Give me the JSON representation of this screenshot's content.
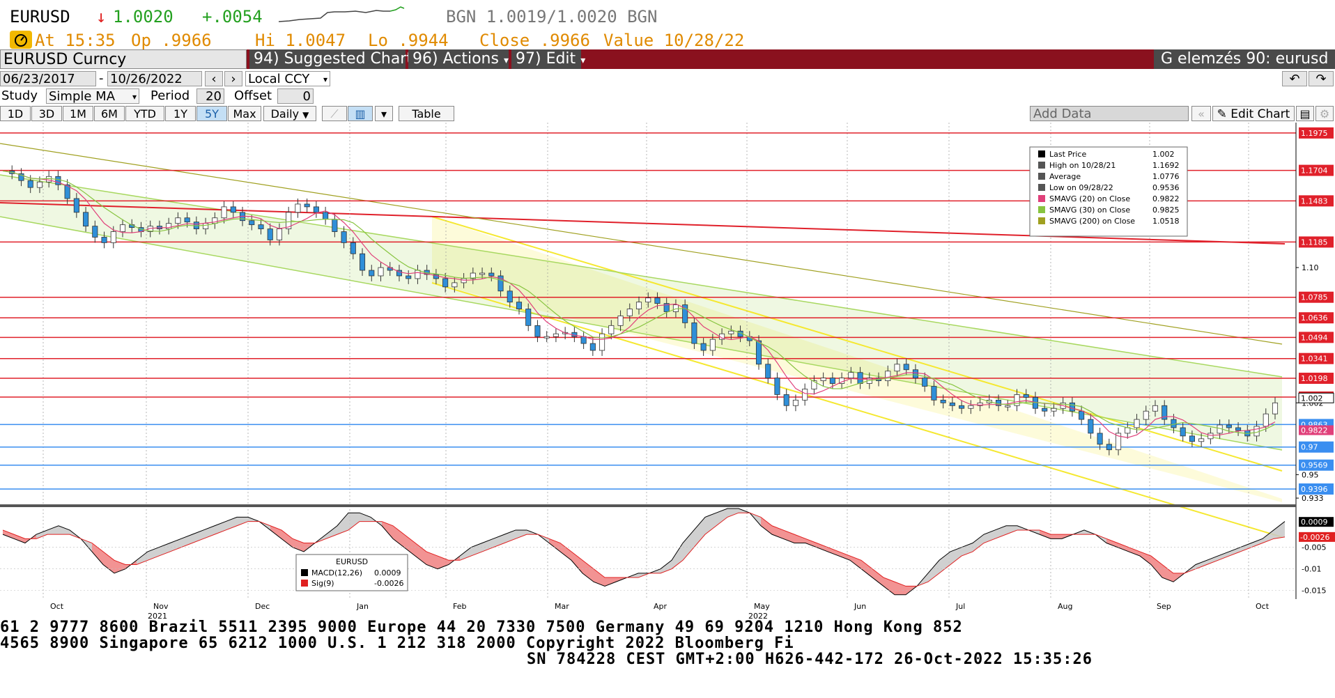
{
  "quote": {
    "symbol": "EURUSD",
    "arrow": "↓",
    "last": "1.0020",
    "change": "+.0054",
    "bid_ask": "BGN 1.0019/1.0020 BGN",
    "time_label": "At 15:35",
    "open_label": "Op .9966",
    "high_label": "Hi 1.0047",
    "low_label": "Lo .9944",
    "close_label": "Close .9966",
    "value_label": "Value 10/28/22"
  },
  "toolbar": {
    "title": "EURUSD Curncy",
    "suggested_charts": "94) Suggested Charts",
    "actions": "96) Actions",
    "edit": "97) Edit",
    "analysis_name": "G elemzés 90: eurusd",
    "start_date": "06/23/2017",
    "end_date": "10/26/2022",
    "currency": "Local CCY",
    "study_label": "Study",
    "study_value": "Simple MA",
    "period_label": "Period",
    "period_value": "20",
    "offset_label": "Offset",
    "offset_value": "0",
    "ranges": [
      "1D",
      "3D",
      "1M",
      "6M",
      "YTD",
      "1Y",
      "5Y",
      "Max"
    ],
    "frequency": "Daily",
    "table_label": "Table",
    "add_data_placeholder": "Add Data",
    "edit_chart": "Edit Chart"
  },
  "colors": {
    "candle_up": "#ffffff",
    "candle_down": "#2f8fd8",
    "sma20": "#e0407a",
    "sma30": "#88c440",
    "sma200": "#a0a020",
    "resistance": "#e0202a",
    "support": "#3a8ef0",
    "yellow_channel": "#f5e830",
    "green_channel": "#a8d860"
  },
  "chart_data": [
    {
      "type": "candlestick",
      "title": "",
      "x_ticks": [
        "Oct",
        "Nov\n2021",
        "Dec",
        "Jan",
        "Feb",
        "Mar",
        "Apr",
        "May\n2022",
        "Jun",
        "Jul",
        "Aug",
        "Sep",
        "Oct"
      ],
      "y_ticks": [
        "1.10",
        "1.002",
        "0.95",
        "0.933"
      ],
      "ylim": [
        0.93,
        1.205
      ],
      "price_path": [
        1.17,
        1.168,
        1.163,
        1.158,
        1.162,
        1.166,
        1.16,
        1.15,
        1.14,
        1.13,
        1.122,
        1.118,
        1.126,
        1.131,
        1.129,
        1.126,
        1.13,
        1.128,
        1.132,
        1.136,
        1.133,
        1.128,
        1.132,
        1.136,
        1.144,
        1.14,
        1.134,
        1.131,
        1.128,
        1.12,
        1.128,
        1.14,
        1.146,
        1.144,
        1.14,
        1.135,
        1.126,
        1.118,
        1.11,
        1.098,
        1.094,
        1.1,
        1.098,
        1.094,
        1.092,
        1.098,
        1.095,
        1.092,
        1.086,
        1.089,
        1.092,
        1.096,
        1.096,
        1.094,
        1.083,
        1.075,
        1.07,
        1.058,
        1.05,
        1.05,
        1.052,
        1.053,
        1.05,
        1.045,
        1.04,
        1.052,
        1.058,
        1.065,
        1.07,
        1.075,
        1.078,
        1.074,
        1.068,
        1.073,
        1.06,
        1.045,
        1.04,
        1.048,
        1.052,
        1.054,
        1.05,
        1.047,
        1.03,
        1.02,
        1.008,
        1.0,
        1.004,
        1.012,
        1.018,
        1.02,
        1.016,
        1.02,
        1.024,
        1.016,
        1.02,
        1.018,
        1.025,
        1.03,
        1.026,
        1.02,
        1.014,
        1.004,
        1.002,
        1.0,
        0.998,
        1.0,
        1.002,
        1.004,
        1.0,
        1.0,
        1.008,
        1.006,
        0.998,
        0.996,
        0.998,
        1.002,
        0.996,
        0.99,
        0.98,
        0.972,
        0.968,
        0.98,
        0.984,
        0.99,
        0.996,
        1.0,
        0.99,
        0.984,
        0.978,
        0.974,
        0.976,
        0.98,
        0.986,
        0.984,
        0.982,
        0.978,
        0.985,
        0.994,
        1.002
      ],
      "resistance_levels": [
        "1.1975",
        "1.1704",
        "1.1483",
        "1.1185",
        "1.0785",
        "1.0636",
        "1.0494",
        "1.0341",
        "1.0198",
        "1.0062"
      ],
      "support_levels": [
        "0.9863",
        "0.97",
        "0.9569",
        "0.9396"
      ],
      "current_price_label": "1.002",
      "sma_tag": "0.9822",
      "legend": {
        "rows": [
          {
            "name": "Last Price",
            "value": "1.002",
            "color": "#000000"
          },
          {
            "name": "High on 10/28/21",
            "value": "1.1692",
            "color": "#555555"
          },
          {
            "name": "Average",
            "value": "1.0776",
            "color": "#555555"
          },
          {
            "name": "Low on 09/28/22",
            "value": "0.9536",
            "color": "#555555"
          },
          {
            "name": "SMAVG (20)  on Close",
            "value": "0.9822",
            "color": "#e0407a"
          },
          {
            "name": "SMAVG (30)  on Close",
            "value": "0.9825",
            "color": "#88c440"
          },
          {
            "name": "SMAVG (200)  on Close",
            "value": "1.0518",
            "color": "#a0a020"
          }
        ],
        "placement": "top-right"
      }
    },
    {
      "type": "line",
      "title": "EURUSD",
      "y_ticks": [
        "-0.005",
        "-0.01",
        "-0.015"
      ],
      "ylim": [
        -0.017,
        0.004
      ],
      "series": [
        {
          "name": "MACD(12,26)",
          "value": "0.0009",
          "color": "#000000"
        },
        {
          "name": "Sig(9)",
          "value": "-0.0026",
          "color": "#e02020"
        }
      ],
      "macd": [
        -0.002,
        -0.003,
        -0.004,
        -0.002,
        -0.001,
        0.0,
        -0.001,
        -0.003,
        -0.006,
        -0.009,
        -0.011,
        -0.01,
        -0.008,
        -0.006,
        -0.005,
        -0.004,
        -0.003,
        -0.002,
        -0.001,
        0.0,
        0.001,
        0.002,
        0.002,
        0.001,
        -0.001,
        -0.003,
        -0.005,
        -0.006,
        -0.004,
        -0.002,
        0.0,
        0.003,
        0.003,
        0.002,
        0.0,
        -0.003,
        -0.005,
        -0.007,
        -0.009,
        -0.01,
        -0.009,
        -0.007,
        -0.005,
        -0.004,
        -0.003,
        -0.002,
        -0.001,
        -0.001,
        -0.002,
        -0.004,
        -0.006,
        -0.008,
        -0.011,
        -0.013,
        -0.014,
        -0.013,
        -0.012,
        -0.011,
        -0.011,
        -0.01,
        -0.008,
        -0.004,
        -0.001,
        0.002,
        0.003,
        0.004,
        0.004,
        0.003,
        0.0,
        -0.002,
        -0.003,
        -0.004,
        -0.004,
        -0.005,
        -0.006,
        -0.007,
        -0.008,
        -0.01,
        -0.012,
        -0.014,
        -0.016,
        -0.016,
        -0.014,
        -0.011,
        -0.008,
        -0.006,
        -0.005,
        -0.004,
        -0.002,
        -0.001,
        0.0,
        0.0,
        -0.001,
        -0.002,
        -0.003,
        -0.003,
        -0.002,
        -0.001,
        -0.002,
        -0.004,
        -0.005,
        -0.006,
        -0.007,
        -0.009,
        -0.012,
        -0.013,
        -0.011,
        -0.009,
        -0.008,
        -0.007,
        -0.006,
        -0.005,
        -0.004,
        -0.003,
        -0.001,
        0.001
      ],
      "signal": [
        -0.001,
        -0.002,
        -0.003,
        -0.003,
        -0.002,
        -0.002,
        -0.002,
        -0.003,
        -0.004,
        -0.006,
        -0.008,
        -0.009,
        -0.009,
        -0.008,
        -0.007,
        -0.006,
        -0.005,
        -0.004,
        -0.003,
        -0.002,
        -0.001,
        0.0,
        0.001,
        0.001,
        0.0,
        -0.001,
        -0.003,
        -0.004,
        -0.004,
        -0.003,
        -0.002,
        -0.001,
        0.001,
        0.001,
        0.001,
        0.0,
        -0.002,
        -0.004,
        -0.006,
        -0.007,
        -0.008,
        -0.008,
        -0.007,
        -0.006,
        -0.005,
        -0.004,
        -0.003,
        -0.002,
        -0.002,
        -0.003,
        -0.004,
        -0.006,
        -0.008,
        -0.01,
        -0.012,
        -0.012,
        -0.012,
        -0.012,
        -0.011,
        -0.011,
        -0.01,
        -0.008,
        -0.005,
        -0.002,
        0.0,
        0.002,
        0.003,
        0.003,
        0.002,
        0.0,
        -0.001,
        -0.002,
        -0.003,
        -0.004,
        -0.005,
        -0.006,
        -0.007,
        -0.008,
        -0.01,
        -0.012,
        -0.013,
        -0.014,
        -0.014,
        -0.013,
        -0.011,
        -0.009,
        -0.007,
        -0.006,
        -0.004,
        -0.003,
        -0.002,
        -0.001,
        -0.001,
        -0.001,
        -0.002,
        -0.002,
        -0.002,
        -0.002,
        -0.002,
        -0.003,
        -0.004,
        -0.005,
        -0.006,
        -0.007,
        -0.009,
        -0.011,
        -0.011,
        -0.01,
        -0.009,
        -0.008,
        -0.007,
        -0.006,
        -0.005,
        -0.004,
        -0.003,
        -0.0026
      ]
    }
  ],
  "footer": {
    "line1": "61 2 9777 8600 Brazil 5511 2395 9000 Europe 44 20 7330 7500 Germany 49 69 9204 1210 Hong Kong 852",
    "line2": " 4565 8900      Singapore 65 6212 1000        U.S. 1 212 318 2000        Copyright 2022 Bloomberg Fi",
    "line3": "SN 784228 CEST GMT+2:00 H626-442-172 26-Oct-2022 15:35:26"
  }
}
